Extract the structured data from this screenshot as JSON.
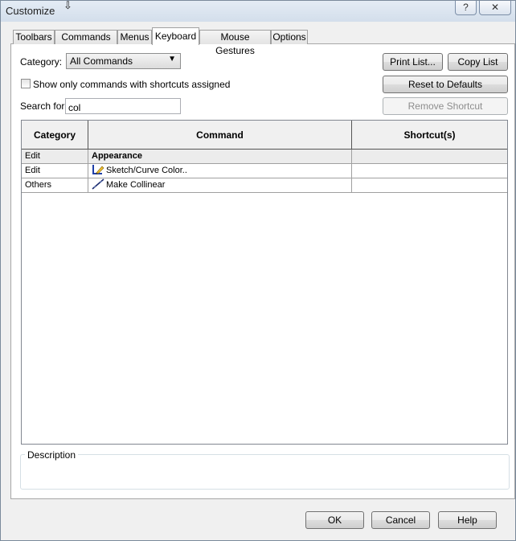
{
  "window": {
    "title": "Customize",
    "help_label": "?",
    "close_label": "✕",
    "cursor_icon": "arrow-cursor-icon"
  },
  "tabs": [
    {
      "label": "Toolbars",
      "active": false
    },
    {
      "label": "Commands",
      "active": false
    },
    {
      "label": "Menus",
      "active": false
    },
    {
      "label": "Keyboard",
      "active": true
    },
    {
      "label": "Mouse Gestures",
      "active": false
    },
    {
      "label": "Options",
      "active": false
    }
  ],
  "filters": {
    "category_label": "Category:",
    "category_value": "All Commands",
    "show_only_label": "Show only commands with shortcuts assigned",
    "show_only_checked": false,
    "search_label": "Search for:",
    "search_value": "col"
  },
  "buttons": {
    "print_list": "Print List...",
    "copy_list": "Copy List",
    "reset_defaults": "Reset to Defaults",
    "remove_shortcut": "Remove Shortcut",
    "ok": "OK",
    "cancel": "Cancel",
    "help": "Help"
  },
  "table": {
    "headers": [
      "Category",
      "Command",
      "Shortcut(s)"
    ],
    "rows": [
      {
        "category": "Edit",
        "command": "Appearance",
        "shortcut": "",
        "group": true,
        "icon": ""
      },
      {
        "category": "Edit",
        "command": "Sketch/Curve Color..",
        "shortcut": "",
        "group": false,
        "icon": "sketch-color-icon"
      },
      {
        "category": "Others",
        "command": "Make Collinear",
        "shortcut": "",
        "group": false,
        "icon": "collinear-line-icon"
      }
    ]
  },
  "description": {
    "label": "Description",
    "text": ""
  },
  "colors": {
    "window_bg": "#f0f0f0",
    "titlebar": "#d3deeb",
    "grid_header": "#f0f0f0",
    "disabled_text": "#8d8d8d"
  }
}
